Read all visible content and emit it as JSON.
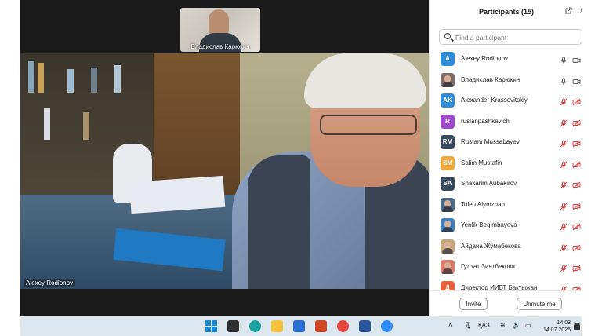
{
  "meeting": {
    "thumbnail_name": "Владислав Карюкин",
    "main_video_name": "Alexey Rodionov"
  },
  "participants_panel": {
    "title": "Participants (15)",
    "search_placeholder": "Find a participant",
    "participants": [
      {
        "name": "Alexey Rodionov",
        "initials": "A",
        "avatar_color": "#2f8cd8",
        "avatar_type": "initials",
        "mic": "on",
        "video": "on"
      },
      {
        "name": "Владислав Карюкин",
        "initials": "",
        "avatar_color": "#7b6e69",
        "avatar_type": "photo",
        "mic": "on",
        "video": "on"
      },
      {
        "name": "Alexander Krassovitskiy",
        "initials": "AK",
        "avatar_color": "#2f8cd8",
        "avatar_type": "initials",
        "mic": "muted",
        "video": "off"
      },
      {
        "name": "ruslanpashkevich",
        "initials": "R",
        "avatar_color": "#a24bc9",
        "avatar_type": "initials",
        "mic": "muted",
        "video": "off"
      },
      {
        "name": "Rustam Mussabayev",
        "initials": "RM",
        "avatar_color": "#394a5e",
        "avatar_type": "initials",
        "mic": "muted",
        "video": "off"
      },
      {
        "name": "Salim Mustafin",
        "initials": "SM",
        "avatar_color": "#f2a93b",
        "avatar_type": "initials",
        "mic": "muted",
        "video": "off"
      },
      {
        "name": "Shakarim Aubakirov",
        "initials": "SA",
        "avatar_color": "#394a5e",
        "avatar_type": "initials",
        "mic": "muted",
        "video": "off"
      },
      {
        "name": "Toleu Alymzhan",
        "initials": "",
        "avatar_color": "#4b6b8a",
        "avatar_type": "photo",
        "mic": "muted",
        "video": "off"
      },
      {
        "name": "Yenlik Begimbayeva",
        "initials": "",
        "avatar_color": "#3d7fbf",
        "avatar_type": "photo",
        "mic": "muted",
        "video": "off"
      },
      {
        "name": "Айдана Жумабекова",
        "initials": "",
        "avatar_color": "#c9a77a",
        "avatar_type": "photo",
        "mic": "muted",
        "video": "off"
      },
      {
        "name": "Гулзат Зиятбекова",
        "initials": "",
        "avatar_color": "#d97a6a",
        "avatar_type": "photo",
        "mic": "muted",
        "video": "off"
      },
      {
        "name": "Директор ИИВТ Бактыжан",
        "initials": "Д",
        "avatar_color": "#e8603a",
        "avatar_type": "initials",
        "mic": "muted",
        "video": "off"
      }
    ],
    "invite_label": "Invite",
    "unmute_label": "Unmute me"
  },
  "taskbar": {
    "language": "ҚАЗ",
    "time": "14:03",
    "date": "14.07.2025",
    "apps": [
      {
        "name": "windows-start",
        "color": "#1a8ad4"
      },
      {
        "name": "task-view",
        "color": "#303030"
      },
      {
        "name": "edge",
        "color": "#1aa3a0"
      },
      {
        "name": "file-explorer",
        "color": "#f4c23c"
      },
      {
        "name": "microsoft-store",
        "color": "#2a6fd1"
      },
      {
        "name": "powerpoint",
        "color": "#d24726"
      },
      {
        "name": "chrome",
        "color": "#e8453c"
      },
      {
        "name": "word",
        "color": "#2b579a"
      },
      {
        "name": "zoom",
        "color": "#2d8cff"
      }
    ]
  },
  "colors": {
    "muted_red": "#d23a3a",
    "accent_blue": "#2d8cff"
  }
}
